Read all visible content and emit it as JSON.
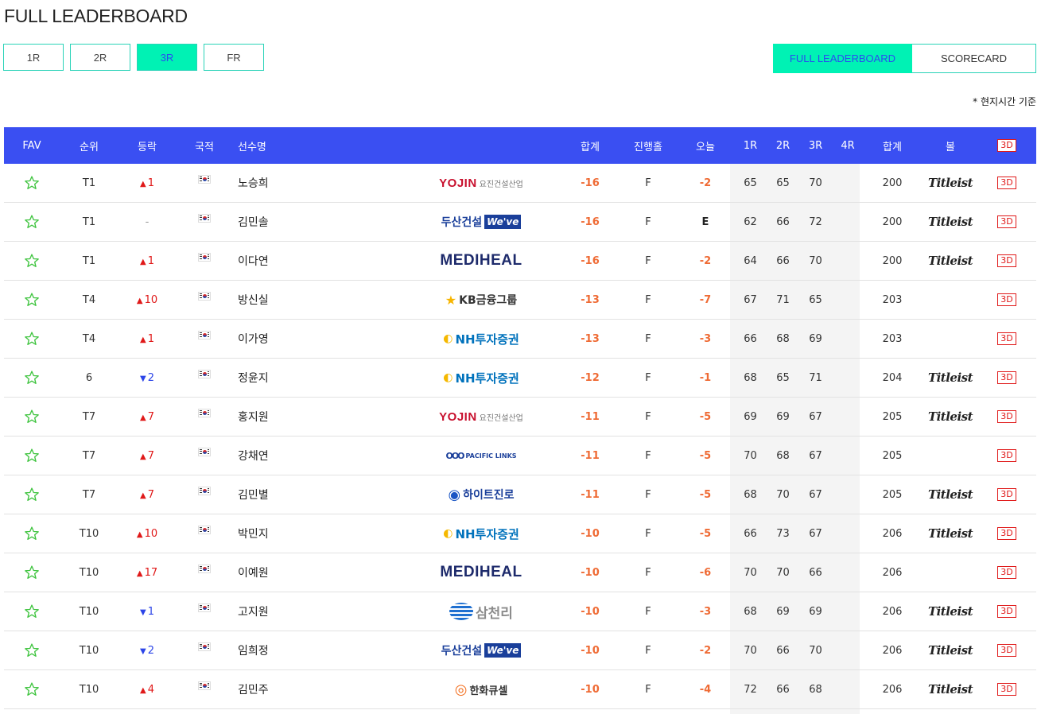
{
  "page_title": "FULL LEADERBOARD",
  "round_tabs": [
    {
      "label": "1R",
      "active": false
    },
    {
      "label": "2R",
      "active": false
    },
    {
      "label": "3R",
      "active": true
    },
    {
      "label": "FR",
      "active": false
    }
  ],
  "view_tabs": {
    "leaderboard": "FULL LEADERBOARD",
    "scorecard": "SCORECARD"
  },
  "time_note": "* 현지시간 기준",
  "headers": {
    "fav": "FAV",
    "rank": "순위",
    "move": "등락",
    "nat": "국적",
    "name": "선수명",
    "total": "합계",
    "thru": "진행홀",
    "today": "오늘",
    "r1": "1R",
    "r2": "2R",
    "r3": "3R",
    "r4": "4R",
    "sum": "합계",
    "ball": "볼",
    "btn3d": "3D"
  },
  "colors": {
    "header_bg": "#3a4ff2",
    "accent": "#00f2b4",
    "score": "#ef6b35",
    "up": "#e01919",
    "down": "#2c45e8"
  },
  "rows": [
    {
      "rank": "T1",
      "dir": "up",
      "move": "1",
      "name": "노승희",
      "sponsor": "yojin",
      "total": "-16",
      "thru": "F",
      "today": "-2",
      "r1": "65",
      "r2": "65",
      "r3": "70",
      "sum": "200",
      "ball": "Titleist",
      "btn3d": "3D"
    },
    {
      "rank": "T1",
      "dir": "none",
      "move": "-",
      "name": "김민솔",
      "sponsor": "doosan",
      "total": "-16",
      "thru": "F",
      "today": "E",
      "r1": "62",
      "r2": "66",
      "r3": "72",
      "sum": "200",
      "ball": "Titleist",
      "btn3d": "3D"
    },
    {
      "rank": "T1",
      "dir": "up",
      "move": "1",
      "name": "이다연",
      "sponsor": "mediheal",
      "total": "-16",
      "thru": "F",
      "today": "-2",
      "r1": "64",
      "r2": "66",
      "r3": "70",
      "sum": "200",
      "ball": "Titleist",
      "btn3d": "3D"
    },
    {
      "rank": "T4",
      "dir": "up",
      "move": "10",
      "name": "방신실",
      "sponsor": "kb",
      "total": "-13",
      "thru": "F",
      "today": "-7",
      "r1": "67",
      "r2": "71",
      "r3": "65",
      "sum": "203",
      "ball": "",
      "btn3d": "3D"
    },
    {
      "rank": "T4",
      "dir": "up",
      "move": "1",
      "name": "이가영",
      "sponsor": "nh",
      "total": "-13",
      "thru": "F",
      "today": "-3",
      "r1": "66",
      "r2": "68",
      "r3": "69",
      "sum": "203",
      "ball": "",
      "btn3d": "3D"
    },
    {
      "rank": "6",
      "dir": "down",
      "move": "2",
      "name": "정윤지",
      "sponsor": "nh",
      "total": "-12",
      "thru": "F",
      "today": "-1",
      "r1": "68",
      "r2": "65",
      "r3": "71",
      "sum": "204",
      "ball": "Titleist",
      "btn3d": "3D"
    },
    {
      "rank": "T7",
      "dir": "up",
      "move": "7",
      "name": "홍지원",
      "sponsor": "yojin",
      "total": "-11",
      "thru": "F",
      "today": "-5",
      "r1": "69",
      "r2": "69",
      "r3": "67",
      "sum": "205",
      "ball": "Titleist",
      "btn3d": "3D"
    },
    {
      "rank": "T7",
      "dir": "up",
      "move": "7",
      "name": "강채연",
      "sponsor": "pacific",
      "total": "-11",
      "thru": "F",
      "today": "-5",
      "r1": "70",
      "r2": "68",
      "r3": "67",
      "sum": "205",
      "ball": "",
      "btn3d": "3D"
    },
    {
      "rank": "T7",
      "dir": "up",
      "move": "7",
      "name": "김민별",
      "sponsor": "hite",
      "total": "-11",
      "thru": "F",
      "today": "-5",
      "r1": "68",
      "r2": "70",
      "r3": "67",
      "sum": "205",
      "ball": "Titleist",
      "btn3d": "3D"
    },
    {
      "rank": "T10",
      "dir": "up",
      "move": "10",
      "name": "박민지",
      "sponsor": "nh",
      "total": "-10",
      "thru": "F",
      "today": "-5",
      "r1": "66",
      "r2": "73",
      "r3": "67",
      "sum": "206",
      "ball": "Titleist",
      "btn3d": "3D"
    },
    {
      "rank": "T10",
      "dir": "up",
      "move": "17",
      "name": "이예원",
      "sponsor": "mediheal",
      "total": "-10",
      "thru": "F",
      "today": "-6",
      "r1": "70",
      "r2": "70",
      "r3": "66",
      "sum": "206",
      "ball": "",
      "btn3d": "3D"
    },
    {
      "rank": "T10",
      "dir": "down",
      "move": "1",
      "name": "고지원",
      "sponsor": "samchully",
      "total": "-10",
      "thru": "F",
      "today": "-3",
      "r1": "68",
      "r2": "69",
      "r3": "69",
      "sum": "206",
      "ball": "Titleist",
      "btn3d": "3D"
    },
    {
      "rank": "T10",
      "dir": "down",
      "move": "2",
      "name": "임희정",
      "sponsor": "doosan",
      "total": "-10",
      "thru": "F",
      "today": "-2",
      "r1": "70",
      "r2": "66",
      "r3": "70",
      "sum": "206",
      "ball": "Titleist",
      "btn3d": "3D"
    },
    {
      "rank": "T10",
      "dir": "up",
      "move": "4",
      "name": "김민주",
      "sponsor": "hanwha",
      "total": "-10",
      "thru": "F",
      "today": "-4",
      "r1": "72",
      "r2": "66",
      "r3": "68",
      "sum": "206",
      "ball": "Titleist",
      "btn3d": "3D"
    }
  ],
  "sponsor_logos": {
    "yojin": [
      "YOJIN",
      "요진건설산업"
    ],
    "doosan": [
      "두산건설",
      "We've"
    ],
    "mediheal": [
      "MEDIHEAL"
    ],
    "kb": [
      "★",
      "KB금융그룹"
    ],
    "nh": [
      "◐",
      "NH투자증권"
    ],
    "pacific": [
      "OOO",
      "PACIFIC LINKS"
    ],
    "hite": [
      "◉",
      "하이트진로"
    ],
    "samchully": [
      "",
      "삼천리"
    ],
    "hanwha": [
      "◎",
      "한화큐셀"
    ]
  }
}
